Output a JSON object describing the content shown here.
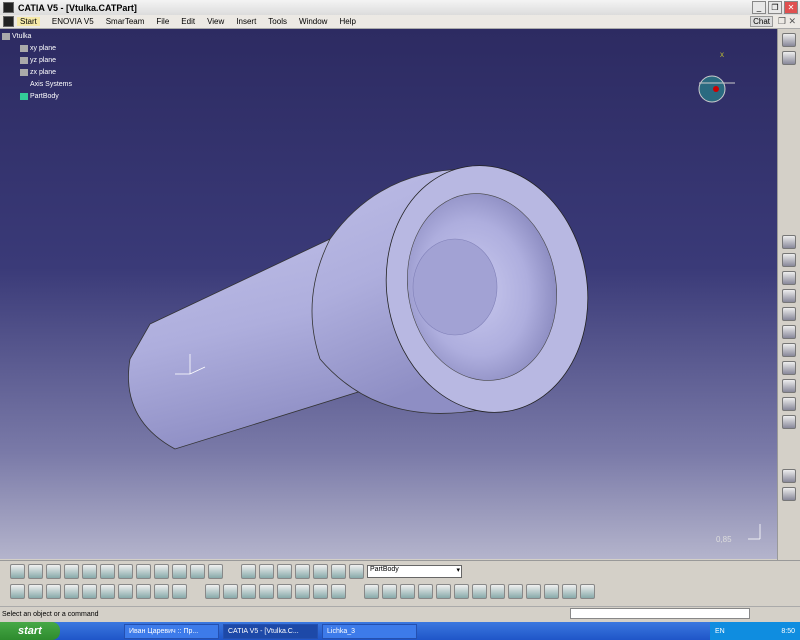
{
  "window": {
    "title": "CATIA V5 - [Vtulka.CATPart]",
    "chat": "Chat"
  },
  "menu": [
    "Start",
    "ENOVIA V5",
    "SmarTeam",
    "File",
    "Edit",
    "View",
    "Insert",
    "Tools",
    "Window",
    "Help"
  ],
  "tree": {
    "root": "Vtulka",
    "items": [
      "xy plane",
      "yz plane",
      "zx plane",
      "Axis Systems",
      "PartBody"
    ]
  },
  "viewport": {
    "scale": "0,85",
    "compass_label": "x"
  },
  "toolbar": {
    "current_body": "PartBody"
  },
  "status": {
    "message": "Select an object or a command"
  },
  "taskbar": {
    "start": "start",
    "tasks": [
      "Иван Царевич :: Пр...",
      "CATIA V5 - [Vtulka.C...",
      "Lichka_3"
    ],
    "lang": "EN",
    "time": "8:50"
  }
}
